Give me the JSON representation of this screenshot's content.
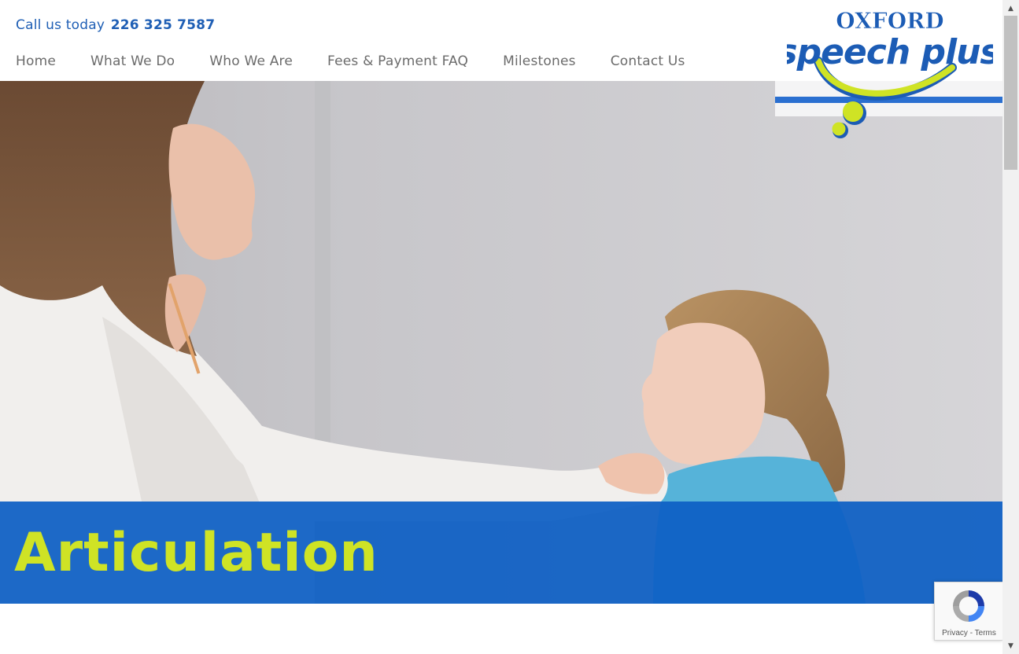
{
  "header": {
    "call_prefix": "Call us today",
    "phone": "226 325 7587"
  },
  "nav": {
    "items": [
      "Home",
      "What We Do",
      "Who We Are",
      "Fees & Payment FAQ",
      "Milestones",
      "Contact Us"
    ]
  },
  "logo": {
    "line1": "OXFORD",
    "line2": "speech plus"
  },
  "hero": {
    "title": "Articulation"
  },
  "recaptcha": {
    "privacy": "Privacy",
    "separator": " - ",
    "terms": "Terms"
  },
  "colors": {
    "brand_blue": "#0d5fc4",
    "brand_lime": "#cfe325",
    "nav_text": "#6b6b6b"
  },
  "icons": [
    "recaptcha-icon",
    "scroll-up-icon",
    "scroll-down-icon"
  ]
}
